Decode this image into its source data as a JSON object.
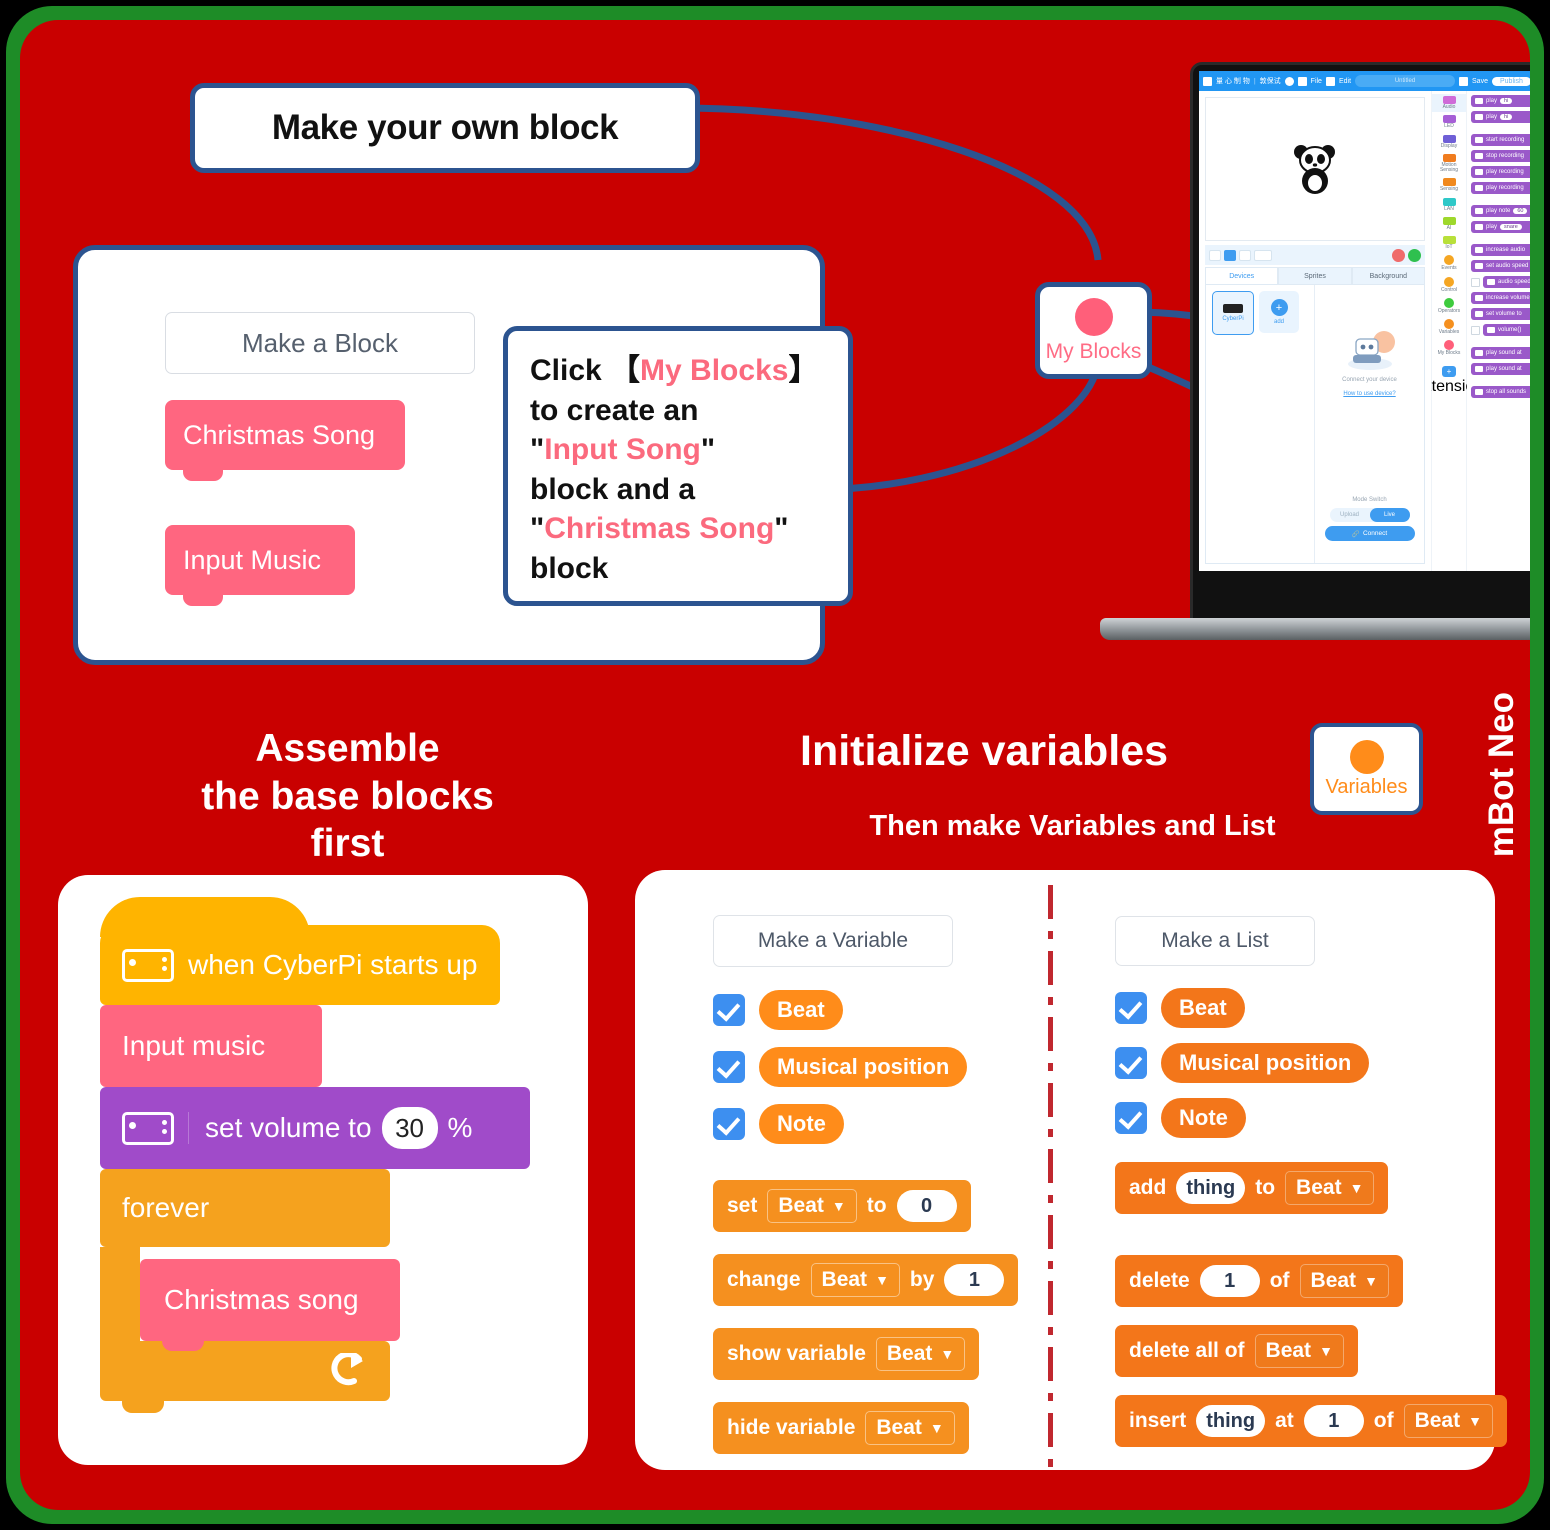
{
  "frame": {
    "outer_color": "#1e8c27",
    "card_color": "#c90000"
  },
  "callout": {
    "title": "Make your own block"
  },
  "block_panel": {
    "make_a_block_label": "Make a Block",
    "my_blocks": [
      {
        "label": "Christmas Song"
      },
      {
        "label": "Input Music"
      }
    ],
    "instruction": {
      "l1_a": "Click 【",
      "l1_b": "My Blocks",
      "l1_c": "】",
      "l2": "to create an",
      "l3_a": "\"",
      "l3_b": "Input Song",
      "l3_c": "\"",
      "l4": "block and a",
      "l5_a": "\"",
      "l5_b": "Christmas Song",
      "l5_c": "\"",
      "l6": "block"
    }
  },
  "badges": {
    "my_blocks": {
      "label": "My Blocks",
      "dot_color": "#ff5f7a"
    },
    "variables": {
      "label": "Variables",
      "dot_color": "#ff8c1a"
    }
  },
  "side_label": {
    "text": "mBot Neo"
  },
  "laptop": {
    "topbar": {
      "menu_cn_1": "量 心 制 物",
      "menu_cn_2": "敦保试",
      "file": "File",
      "edit": "Edit",
      "project_name": "Untitled",
      "save": "Save",
      "publish": "Publish"
    },
    "tabs": [
      "Devices",
      "Sprites",
      "Background"
    ],
    "devices": [
      {
        "name": "CyberPi"
      },
      {
        "name": "add"
      }
    ],
    "connect_caption": "Connect your device",
    "how_to_link": "How to use device?",
    "mode_switch_label": "Mode Switch",
    "mode_upload": "Upload",
    "mode_live": "Live",
    "connect_button": "Connect",
    "categories": [
      {
        "label": "Audio",
        "color": "#cf6bd8",
        "shape": "chip",
        "active": true
      },
      {
        "label": "LED",
        "color": "#a65fd6",
        "shape": "chip",
        "active": false
      },
      {
        "label": "Display",
        "color": "#6f5fd6",
        "shape": "chip",
        "active": false
      },
      {
        "label": "Motion Sensing",
        "color": "#f07c1e",
        "shape": "chip",
        "active": false
      },
      {
        "label": "Sensing",
        "color": "#f0891e",
        "shape": "chip",
        "active": false
      },
      {
        "label": "LAN",
        "color": "#2fc8c8",
        "shape": "chip",
        "active": false
      },
      {
        "label": "AI",
        "color": "#9ed82c",
        "shape": "chip",
        "active": false
      },
      {
        "label": "IoT",
        "color": "#b8e03a",
        "shape": "chip",
        "active": false
      },
      {
        "label": "Events",
        "color": "#f5a623",
        "shape": "dot",
        "active": false
      },
      {
        "label": "Control",
        "color": "#f5a623",
        "shape": "dot",
        "active": false
      },
      {
        "label": "Operators",
        "color": "#3ecb3e",
        "shape": "dot",
        "active": false
      },
      {
        "label": "Variables",
        "color": "#f5901f",
        "shape": "dot",
        "active": false
      },
      {
        "label": "My Blocks",
        "color": "#ff5f7a",
        "shape": "dot",
        "active": false
      }
    ],
    "extension_label": "extension",
    "palette": [
      {
        "text": "play",
        "arg": "hi",
        "tail": "u",
        "check": false
      },
      {
        "text": "play",
        "arg": "hi",
        "tail": "",
        "check": false
      },
      {
        "gap": true
      },
      {
        "text": "start recording",
        "arg": "",
        "tail": "",
        "check": false
      },
      {
        "text": "stop recording",
        "arg": "",
        "tail": "",
        "check": false
      },
      {
        "text": "play recording",
        "arg": "",
        "tail": "",
        "check": false
      },
      {
        "text": "play recording",
        "arg": "",
        "tail": "",
        "check": false
      },
      {
        "gap": true
      },
      {
        "text": "play note",
        "arg": "60",
        "tail": "",
        "check": false
      },
      {
        "text": "play",
        "arg": "snare",
        "tail": "",
        "check": false
      },
      {
        "gap": true
      },
      {
        "text": "increase audio",
        "arg": "",
        "tail": "",
        "check": false
      },
      {
        "text": "set audio speed",
        "arg": "",
        "tail": "",
        "check": false
      },
      {
        "text": "audio speed",
        "arg": "",
        "tail": "",
        "check": true
      },
      {
        "text": "increase volume",
        "arg": "",
        "tail": "",
        "check": false
      },
      {
        "text": "set volume to",
        "arg": "",
        "tail": "",
        "check": false
      },
      {
        "text": "volume()",
        "arg": "",
        "tail": "",
        "check": true
      },
      {
        "gap": true
      },
      {
        "text": "play sound at",
        "arg": "",
        "tail": "",
        "check": false
      },
      {
        "text": "play sound at",
        "arg": "",
        "tail": "",
        "check": false
      },
      {
        "gap": true
      },
      {
        "text": "stop all sounds",
        "arg": "",
        "tail": "",
        "check": false
      }
    ]
  },
  "assemble": {
    "heading_l1": "Assemble",
    "heading_l2": "the base blocks",
    "heading_l3": "first",
    "blocks": [
      {
        "name": "hat",
        "label": "when CyberPi starts up",
        "color": "#ffb400",
        "icon": "cyberpi-icon"
      },
      {
        "name": "input",
        "label": "Input music",
        "color": "#ff6680",
        "icon": ""
      },
      {
        "name": "volume",
        "label": "set volume to",
        "value": "30",
        "suffix": "%",
        "color": "#a04bc9",
        "icon": "cyberpi-icon"
      },
      {
        "name": "forever",
        "label": "forever",
        "color": "#f5a21e",
        "icon": ""
      },
      {
        "name": "xmas",
        "label": "Christmas song",
        "color": "#ff6680",
        "icon": ""
      }
    ]
  },
  "initialize": {
    "heading": "Initialize variables",
    "subheading": "Then make Variables and List",
    "variables_column": {
      "button": "Make a Variable",
      "checked_items": [
        "Beat",
        "Musical position",
        "Note"
      ],
      "blocks": [
        {
          "kind": "set",
          "pre": "set",
          "dropdown": "Beat",
          "mid": "to",
          "value": "0"
        },
        {
          "kind": "change",
          "pre": "change",
          "dropdown": "Beat",
          "mid": "by",
          "value": "1"
        },
        {
          "kind": "show",
          "pre": "show variable",
          "dropdown": "Beat",
          "mid": "",
          "value": ""
        },
        {
          "kind": "hide",
          "pre": "hide variable",
          "dropdown": "Beat",
          "mid": "",
          "value": ""
        }
      ]
    },
    "list_column": {
      "button": "Make a List",
      "checked_items": [
        "Beat",
        "Musical position",
        "Note"
      ],
      "blocks": [
        {
          "kind": "add",
          "pre": "add",
          "value": "thing",
          "mid": "to",
          "dropdown": "Beat"
        },
        {
          "kind": "delete",
          "pre": "delete",
          "value": "1",
          "mid": "of",
          "dropdown": "Beat"
        },
        {
          "kind": "deleteall",
          "pre": "delete all of",
          "value": "",
          "mid": "",
          "dropdown": "Beat"
        },
        {
          "kind": "insert",
          "pre": "insert",
          "value": "thing",
          "mid": "at",
          "value2": "1",
          "mid2": "of",
          "dropdown": "Beat"
        }
      ]
    }
  }
}
